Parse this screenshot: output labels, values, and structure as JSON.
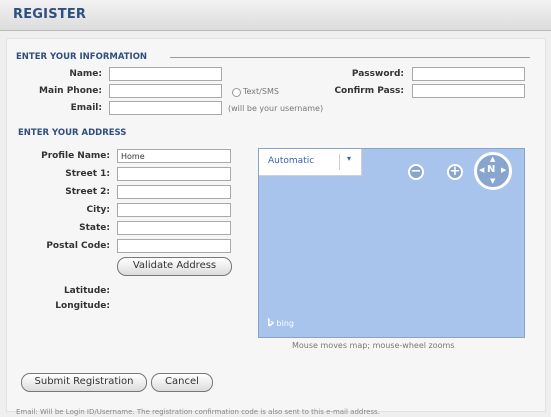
{
  "header": {
    "title": "REGISTER"
  },
  "info": {
    "section_title": "ENTER YOUR INFORMATION",
    "name_label": "Name:",
    "password_label": "Password:",
    "main_phone_label": "Main Phone:",
    "text_sms_label": "Text/SMS",
    "confirm_pass_label": "Confirm Pass:",
    "email_label": "Email:",
    "email_hint": "(will be your username)",
    "name_value": "",
    "password_value": "",
    "main_phone_value": "",
    "confirm_pass_value": "",
    "email_value": ""
  },
  "address": {
    "section_title": "ENTER YOUR ADDRESS",
    "profile_name_label": "Profile Name:",
    "profile_name_value": "Home",
    "street1_label": "Street 1:",
    "street2_label": "Street 2:",
    "city_label": "City:",
    "state_label": "State:",
    "postal_code_label": "Postal Code:",
    "validate_button": "Validate Address",
    "latitude_label": "Latitude:",
    "longitude_label": "Longitude:"
  },
  "map": {
    "mode_label": "Automatic",
    "dropdown_arrow": "▾",
    "zoom_out": "−",
    "zoom_in": "+",
    "compass_label": "N",
    "brand": "bing",
    "note": "Mouse moves map; mouse-wheel zooms",
    "background_color": "#a8c4ec"
  },
  "actions": {
    "submit_button": "Submit Registration",
    "cancel_button": "Cancel"
  },
  "footer": {
    "note": "Email: Will be Login ID/Username. The registration confirmation code is also sent to this e-mail address."
  },
  "colors": {
    "section_title": "#2f4f7f",
    "map_link": "#3b64a8"
  }
}
